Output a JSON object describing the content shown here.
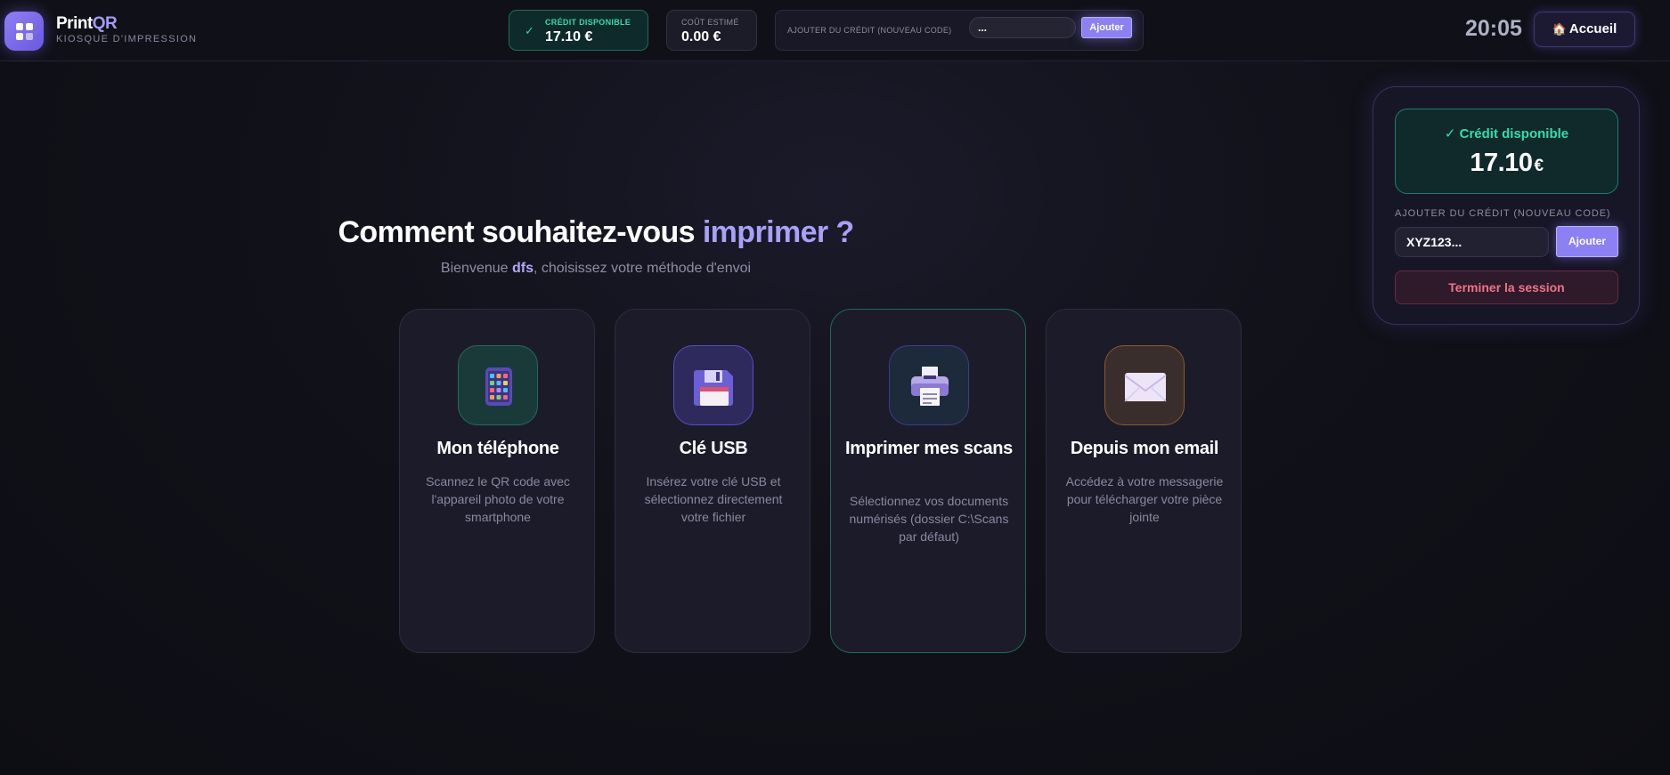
{
  "header": {
    "brand_name_main": "Print",
    "brand_name_accent": "QR",
    "brand_subtitle": "KIOSQUE D'IMPRESSION",
    "credit_label": "CRÉDIT DISPONIBLE",
    "credit_value": "17.10 €",
    "cost_label": "COÛT ESTIMÉ",
    "cost_value": "0.00 €",
    "add_credit_label": "AJOUTER DU CRÉDIT (NOUVEAU CODE)",
    "add_credit_input_value": "...",
    "add_credit_button": "Ajouter",
    "clock": "20:05",
    "home_button": "Accueil",
    "home_icon": "house-icon"
  },
  "main": {
    "title_part1": "Comment souhaitez-vous",
    "title_part2": "imprimer ?",
    "subtitle_before": "Bienvenue ",
    "username": "dfs",
    "subtitle_after": ", choisissez votre méthode d'envoi",
    "cards": [
      {
        "icon": "tablet-icon",
        "title": "Mon téléphone",
        "description": "Scannez le QR code avec l'appareil photo de votre smartphone",
        "accent_color": "#1f6b60"
      },
      {
        "icon": "floppy-disk-icon",
        "title": "Clé USB",
        "description": "Insérez votre clé USB et sélectionnez directement votre fichier",
        "accent_color": "#5a4cc9"
      },
      {
        "icon": "printer-icon",
        "title": "Imprimer mes scans",
        "description": "Sélectionnez vos documents numérisés (dossier C:\\Scans par défaut)",
        "accent_color": "#3a3f8a"
      },
      {
        "icon": "envelope-icon",
        "title": "Depuis mon email",
        "description": "Accédez à votre messagerie pour télécharger votre pièce jointe",
        "accent_color": "#8a5a2a"
      }
    ]
  },
  "panel": {
    "credit_label": "Crédit disponible",
    "credit_amount": "17.10",
    "currency": "€",
    "add_credit_label": "AJOUTER DU CRÉDIT (NOUVEAU CODE)",
    "input_placeholder": "XYZ123...",
    "add_button": "Ajouter",
    "end_session_button": "Terminer la session"
  },
  "colors": {
    "accent": "#8d80f5",
    "success": "#33dcaa",
    "danger": "#f07388"
  }
}
